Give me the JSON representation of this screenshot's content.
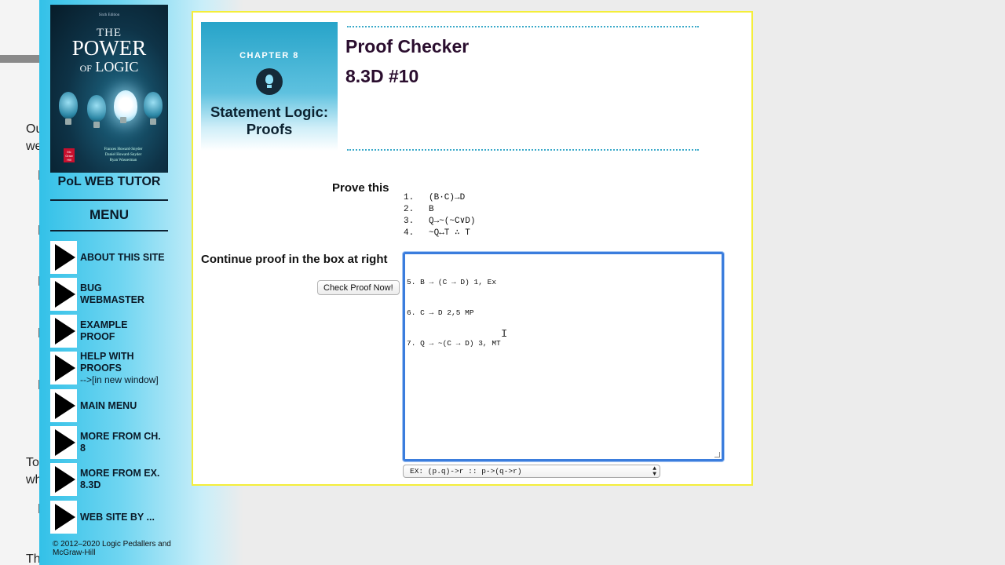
{
  "background_page": {
    "fragments": [
      "Ou",
      "we",
      "To",
      "wh",
      "Th"
    ]
  },
  "sidebar": {
    "cover": {
      "edition": "Sixth Edition",
      "title_line1": "THE",
      "title_line2": "POWER",
      "title_line3_small": "OF",
      "title_line3": "LOGIC",
      "publisher_logo": "Mc Graw Hill",
      "authors": [
        "Frances Howard-Snyder",
        "Daniel Howard-Snyder",
        "Ryan Wasserman"
      ]
    },
    "tutor_title": "PoL WEB TUTOR",
    "menu_title": "MENU",
    "items": [
      {
        "label": "ABOUT THIS SITE",
        "sub": ""
      },
      {
        "label": "BUG WEBMASTER",
        "sub": ""
      },
      {
        "label": "EXAMPLE PROOF",
        "sub": ""
      },
      {
        "label": "HELP WITH PROOFS",
        "sub": "-->[in new window]"
      },
      {
        "label": "MAIN MENU",
        "sub": ""
      },
      {
        "label": "MORE FROM CH. 8",
        "sub": ""
      },
      {
        "label": "MORE FROM EX. 8.3D",
        "sub": ""
      },
      {
        "label": "WEB SITE BY ...",
        "sub": ""
      }
    ],
    "copyright": "© 2012–2020 Logic Pedallers and McGraw-Hill"
  },
  "chapter_card": {
    "chapter": "CHAPTER 8",
    "title_line1": "Statement Logic:",
    "title_line2": "Proofs"
  },
  "header": {
    "title": "Proof Checker",
    "subtitle": "8.3D #10"
  },
  "problem": {
    "prove_label": "Prove this",
    "premises": [
      {
        "num": "1.",
        "text": "(B·C)→D"
      },
      {
        "num": "2.",
        "text": "B"
      },
      {
        "num": "3.",
        "text": "Q→~(~C∨D)"
      },
      {
        "num": "4.",
        "text": "~Q↔T ∴ T"
      }
    ]
  },
  "proof": {
    "continue_label": "Continue proof in the box at right",
    "check_button": "Check Proof Now!",
    "lines": [
      "5. B → (C → D) 1, Ex",
      "6. C → D 2,5 MP",
      "7. Q → ~(C → D) 3, MT"
    ]
  },
  "example_select": {
    "selected": "EX: (p.q)->r :: p->(q->r)"
  },
  "colors": {
    "sidebar_accent": "#33c1e8",
    "panel_border": "#f4ee3a",
    "title_color": "#2a0d2e",
    "focus_ring": "#3b7ddd"
  }
}
